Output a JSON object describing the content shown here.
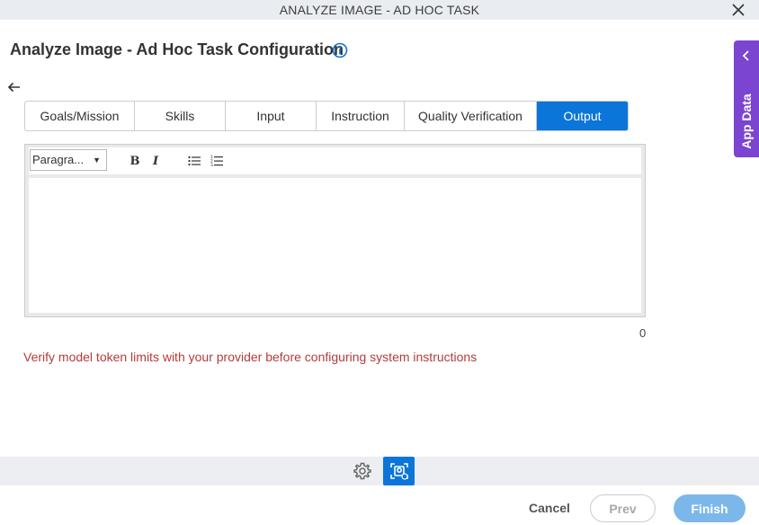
{
  "window": {
    "title": "ANALYZE IMAGE - AD HOC TASK"
  },
  "page": {
    "title": "Analyze Image - Ad Hoc Task Configuration"
  },
  "tabs": [
    {
      "label": "Goals/Mission",
      "active": false
    },
    {
      "label": "Skills",
      "active": false
    },
    {
      "label": "Input",
      "active": false
    },
    {
      "label": "Instruction",
      "active": false
    },
    {
      "label": "Quality Verification",
      "active": false
    },
    {
      "label": "Output",
      "active": true
    }
  ],
  "editor": {
    "paragraph_select": "Paragra...",
    "bold_label": "B",
    "italic_label": "I",
    "content": "",
    "char_count": "0"
  },
  "warning": "Verify model token limits with your provider before configuring system instructions",
  "footer": {
    "cancel": "Cancel",
    "prev": "Prev",
    "finish": "Finish"
  },
  "side_panel": {
    "label": "App Data"
  },
  "colors": {
    "accent": "#0b75d9",
    "side_panel": "#7b44d1",
    "warning": "#b53b3b",
    "finish_disabled": "#7cb7ea"
  }
}
